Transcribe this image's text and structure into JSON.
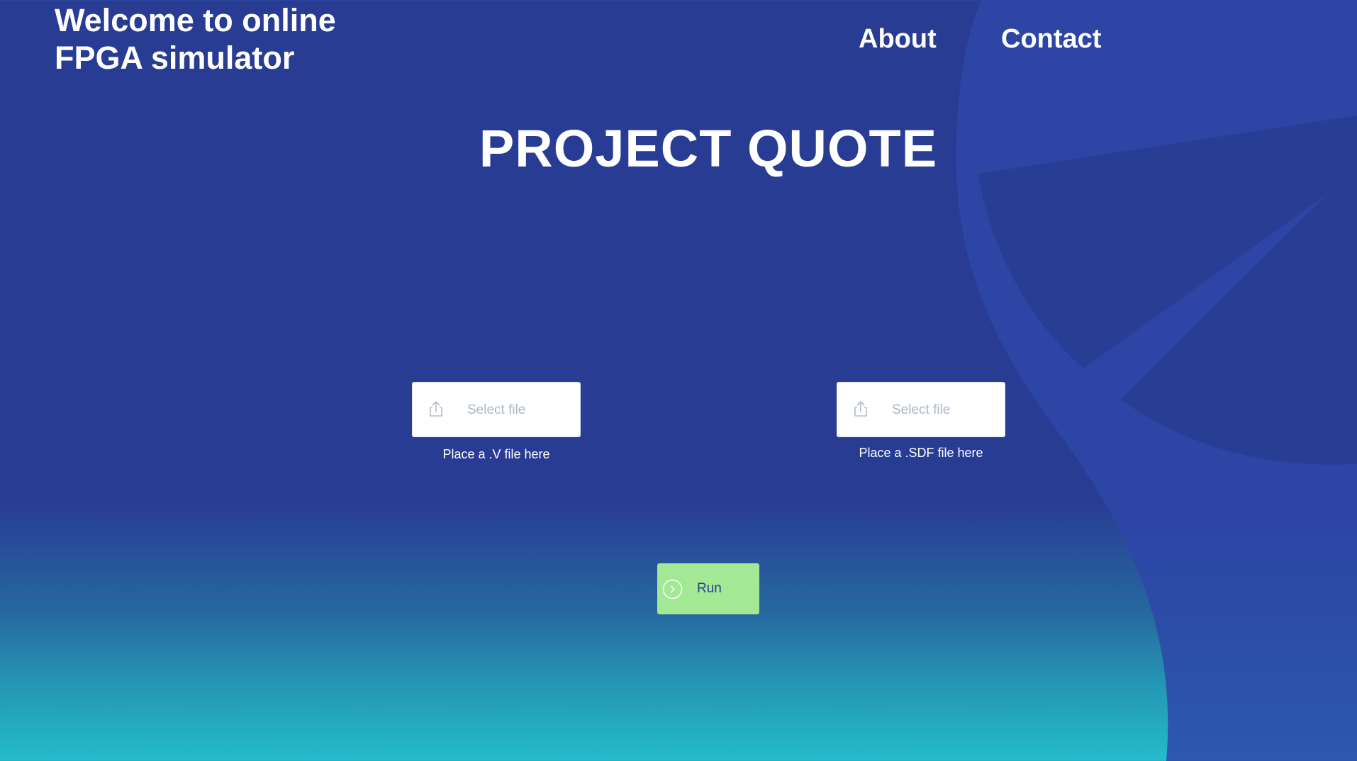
{
  "header": {
    "site_title": "Welcome to online FPGA simulator",
    "nav": [
      {
        "label": "About"
      },
      {
        "label": "Contact"
      }
    ]
  },
  "main": {
    "heading": "PROJECT QUOTE",
    "uploads": [
      {
        "placeholder": "Select file",
        "hint": "Place a .V file here",
        "icon": "upload-icon"
      },
      {
        "placeholder": "Select file",
        "hint": "Place a .SDF file here",
        "icon": "upload-icon"
      }
    ],
    "run_button": {
      "label": "Run",
      "icon": "chevron-right-circle-icon"
    }
  },
  "colors": {
    "background_top": "#293c94",
    "background_bottom": "#24bccc",
    "decor_shape": "#2e47a8",
    "run_button": "#a3e894",
    "run_text": "#2a3f8f",
    "upload_placeholder": "#a9b6c8"
  }
}
